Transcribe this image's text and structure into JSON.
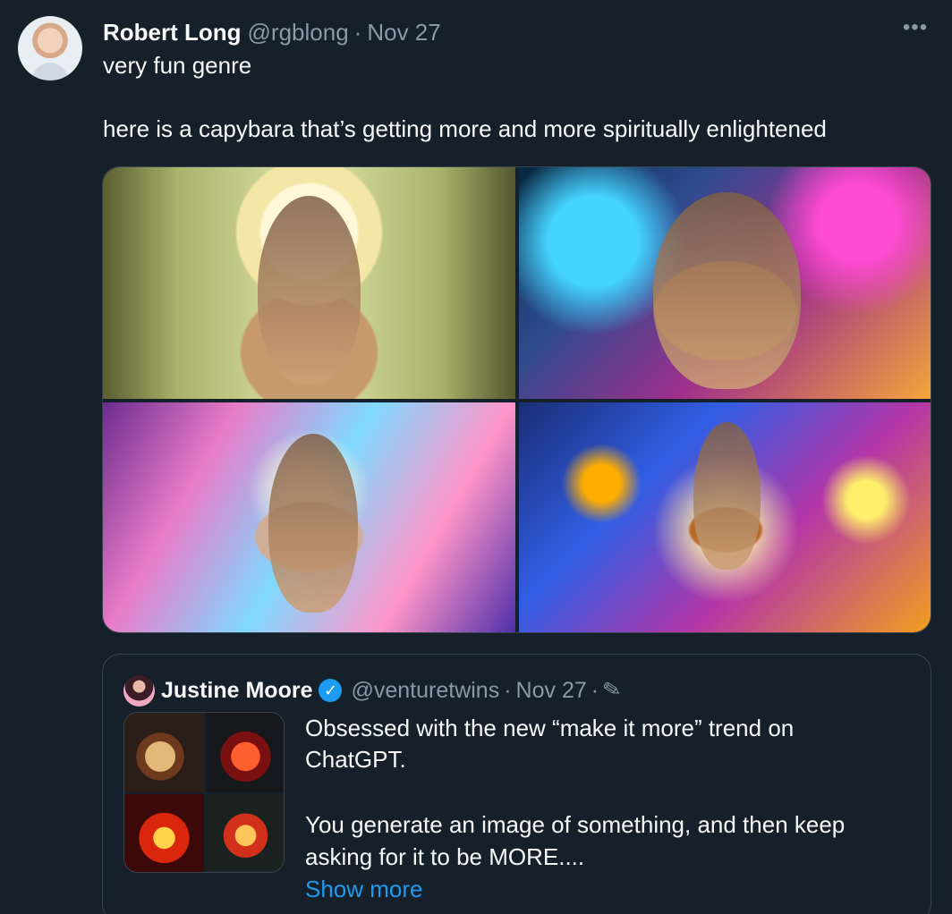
{
  "tweet": {
    "author_name": "Robert Long",
    "handle": "@rgblong",
    "separator": "·",
    "date": "Nov 27",
    "menu_icon": "more-horizontal-icon",
    "text_line1": "very fun genre",
    "text_line2": "here is a capybara that’s getting more and more spiritually enlightened"
  },
  "quoted_tweet": {
    "author_name": "Justine Moore",
    "verified_icon": "verified-badge-icon",
    "handle": "@venturetwins",
    "separator": "·",
    "date": "Nov 27",
    "edited_icon": "edit-pencil-icon",
    "text_line1": "Obsessed with the new “make it more” trend on",
    "text_line2": "ChatGPT.",
    "text_line3": "You generate an image of something, and then keep",
    "text_line4": "asking for it to be MORE....",
    "show_more": "Show more"
  },
  "colors": {
    "background": "#15202b",
    "primary_text": "#f7f9f9",
    "secondary_text": "#8b98a5",
    "border": "#38444d",
    "link": "#1d9bf0"
  }
}
